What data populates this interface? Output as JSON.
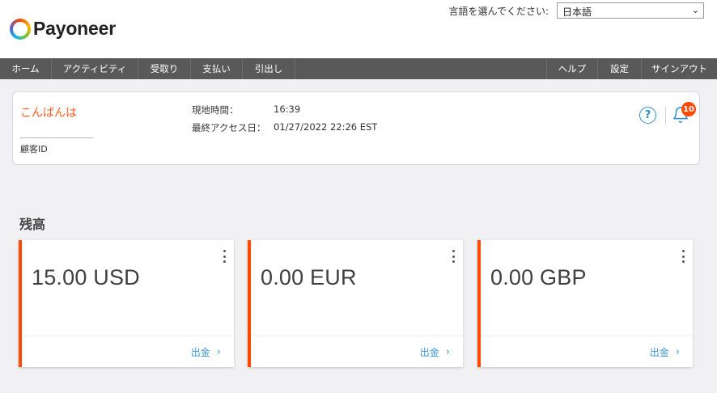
{
  "brand": {
    "name": "Payoneer"
  },
  "language": {
    "label": "言語を選んでください:",
    "selected": "日本語"
  },
  "nav": {
    "left": [
      {
        "label": "ホーム",
        "w": 64
      },
      {
        "label": "アクティビティ",
        "w": 107
      },
      {
        "label": "受取り",
        "w": 65
      },
      {
        "label": "支払い",
        "w": 64
      },
      {
        "label": "引出し",
        "w": 65
      }
    ],
    "right": [
      {
        "label": "ヘルプ",
        "w": 63
      },
      {
        "label": "設定",
        "w": 54
      },
      {
        "label": "サインアウト",
        "w": 94
      }
    ]
  },
  "account": {
    "greeting": "こんばんは",
    "customer_id_label": "顧客ID",
    "local_time_label": "現地時間：",
    "local_time": "16:39",
    "last_access_label": "最終アクセス日：",
    "last_access": "01/27/2022 22:26 EST",
    "notification_count": "10"
  },
  "balances": {
    "title": "残高",
    "cards": [
      {
        "amount": "15.00 USD",
        "action": "出金"
      },
      {
        "amount": "0.00 EUR",
        "action": "出金"
      },
      {
        "amount": "0.00 GBP",
        "action": "出金"
      }
    ]
  },
  "colors": {
    "accent": "#ff4800",
    "link": "#3b97d8",
    "nav_bg": "#595959"
  }
}
